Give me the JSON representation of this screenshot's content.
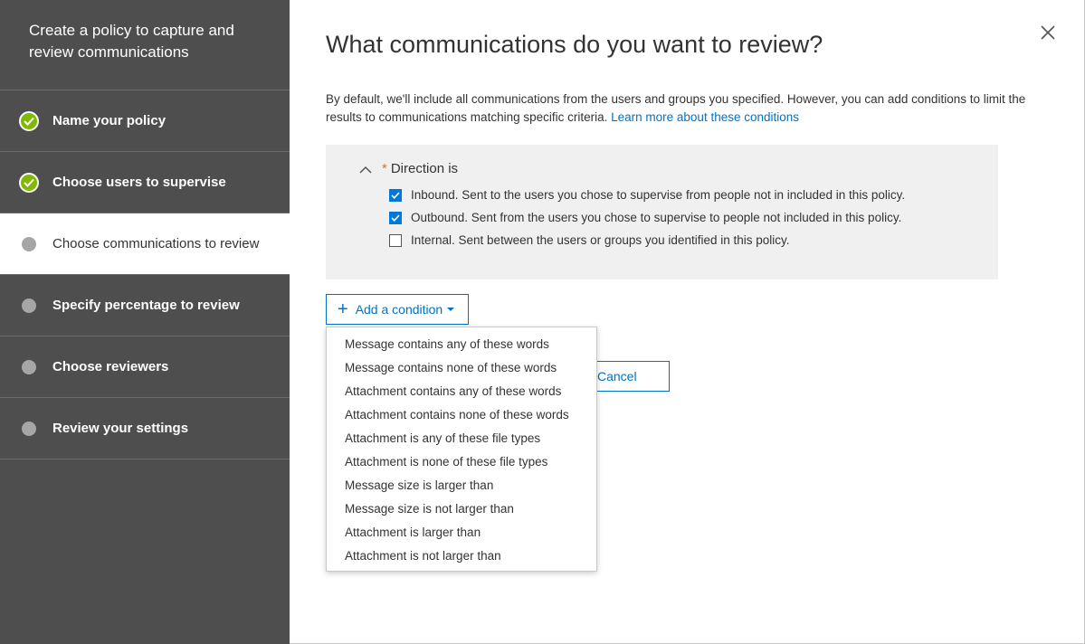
{
  "sidebar": {
    "title": "Create a policy to capture and review communications",
    "steps": [
      {
        "label": "Name your policy",
        "state": "complete"
      },
      {
        "label": "Choose users to supervise",
        "state": "complete"
      },
      {
        "label": "Choose communications to review",
        "state": "current"
      },
      {
        "label": "Specify percentage to review",
        "state": "pending"
      },
      {
        "label": "Choose reviewers",
        "state": "pending"
      },
      {
        "label": "Review your settings",
        "state": "pending"
      }
    ]
  },
  "main": {
    "title": "What communications do you want to review?",
    "intro_text": "By default, we'll include all communications from the users and groups you specified. However, you can add conditions to limit the results to communications matching specific criteria. ",
    "intro_link": "Learn more about these conditions",
    "condition": {
      "required_mark": "*",
      "label": "Direction is",
      "options": [
        {
          "label": "Inbound. Sent to the users you chose to supervise from people not in included in this policy.",
          "checked": true
        },
        {
          "label": "Outbound. Sent from the users you chose to supervise to people not included in this policy.",
          "checked": true
        },
        {
          "label": "Internal. Sent between the users or groups you identified in this policy.",
          "checked": false
        }
      ]
    },
    "add_condition_label": "Add a condition",
    "cancel_label": "Cancel",
    "dropdown_items": [
      "Message contains any of these words",
      "Message contains none of these words",
      "Attachment contains any of these words",
      "Attachment contains none of these words",
      "Attachment is any of these file types",
      "Attachment is none of these file types",
      "Message size is larger than",
      "Message size is not larger than",
      "Attachment is larger than",
      "Attachment is not larger than"
    ]
  },
  "colors": {
    "sidebar_bg": "#4e4e4e",
    "accent": "#0072c6",
    "complete_green": "#7fba00",
    "required_orange": "#e3740b",
    "checkbox_blue": "#0078d7"
  }
}
